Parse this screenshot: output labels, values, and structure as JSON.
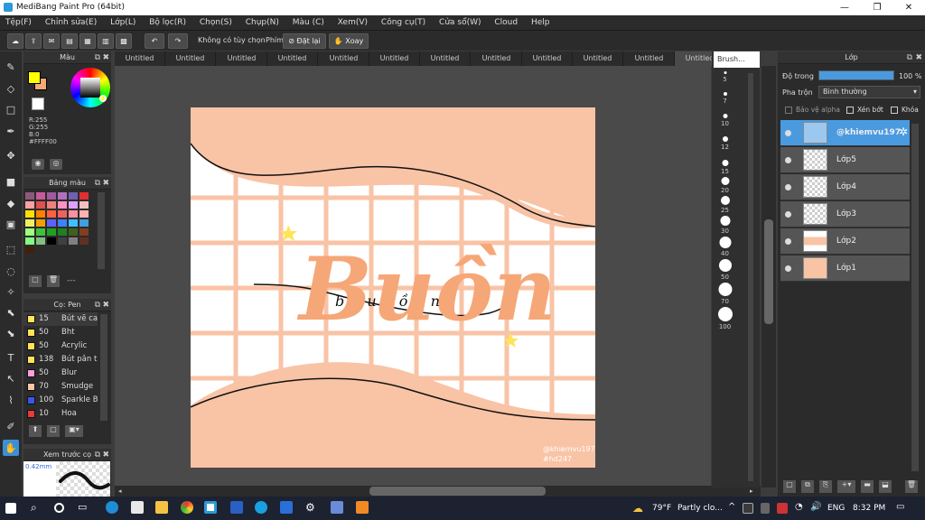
{
  "window": {
    "title": "MediBang Paint Pro (64bit)",
    "min": "—",
    "max": "❐",
    "close": "✕"
  },
  "menu": [
    "Tệp(F)",
    "Chỉnh sửa(E)",
    "Lớp(L)",
    "Bộ lọc(R)",
    "Chọn(S)",
    "Chụp(N)",
    "Màu (C)",
    "Xem(V)",
    "Công cụ(T)",
    "Cửa sổ(W)",
    "Cloud",
    "Help"
  ],
  "toolbar": {
    "selection_label": "Không có tùy chọn",
    "keys_label": "Phím",
    "reset_label": "Đặt lại",
    "rotate_label": "Xoay"
  },
  "tabs": [
    "Untitled",
    "Untitled",
    "Untitled",
    "Untitled",
    "Untitled",
    "Untitled",
    "Untitled",
    "Untitled",
    "Untitled",
    "Untitled",
    "Untitled",
    "Untitled"
  ],
  "brush_popup_title": "Brush...",
  "color_panel": {
    "title": "Màu",
    "r": "R:255",
    "g": "G:255",
    "b": "B:0",
    "hex": "#FFFF00",
    "primary": "#ffff00",
    "secondary": "#f7a878"
  },
  "palette_panel": {
    "title": "Bảng màu",
    "dash": "---"
  },
  "brush_panel": {
    "title": "Cọ: Pen",
    "items": [
      {
        "size": "15",
        "name": "Bút vẽ ca",
        "color": "#ffe45a"
      },
      {
        "size": "50",
        "name": "Bht",
        "color": "#ffe45a"
      },
      {
        "size": "50",
        "name": "Acrylic",
        "color": "#ffe45a"
      },
      {
        "size": "138",
        "name": "Bút pân t",
        "color": "#ffe45a"
      },
      {
        "size": "50",
        "name": "Blur",
        "color": "#ff9ee0"
      },
      {
        "size": "70",
        "name": "Smudge",
        "color": "#f9c7a8"
      },
      {
        "size": "100",
        "name": "Sparkle B",
        "color": "#3a56e8"
      },
      {
        "size": "10",
        "name": "Hoa",
        "color": "#e83a3a"
      }
    ]
  },
  "preview_panel": {
    "title": "Xem trước cọ",
    "size": "0.42mm"
  },
  "brush_sizes": [
    "5",
    "",
    "7",
    "",
    "10",
    "",
    "12",
    "",
    "15",
    "20",
    "25",
    "30",
    "40",
    "50",
    "70",
    "100"
  ],
  "layer_panel": {
    "title": "Lớp",
    "opacity_label": "Độ trong",
    "opacity_value": "100 %",
    "opacity": 1.0,
    "blend_label": "Pha trộn",
    "blend_value": "Bình thường",
    "protect_alpha": "Bảo vệ alpha",
    "clip": "Xén bớt",
    "lock": "Khóa",
    "layers": [
      "@khiemvu197",
      "Lớp5",
      "Lớp4",
      "Lớp3",
      "Lớp2",
      "Lớp1"
    ]
  },
  "artwork": {
    "title_text": "Buồn",
    "script_text": "b u ồ n",
    "watermark1": "@khiemvu197",
    "watermark2": "#hd247",
    "bg": "#f9c3a5",
    "accent": "#f6a777"
  },
  "taskbar": {
    "weather_temp": "79°F",
    "weather_desc": "Partly clo...",
    "lang": "ENG",
    "time": "8:32 PM"
  }
}
